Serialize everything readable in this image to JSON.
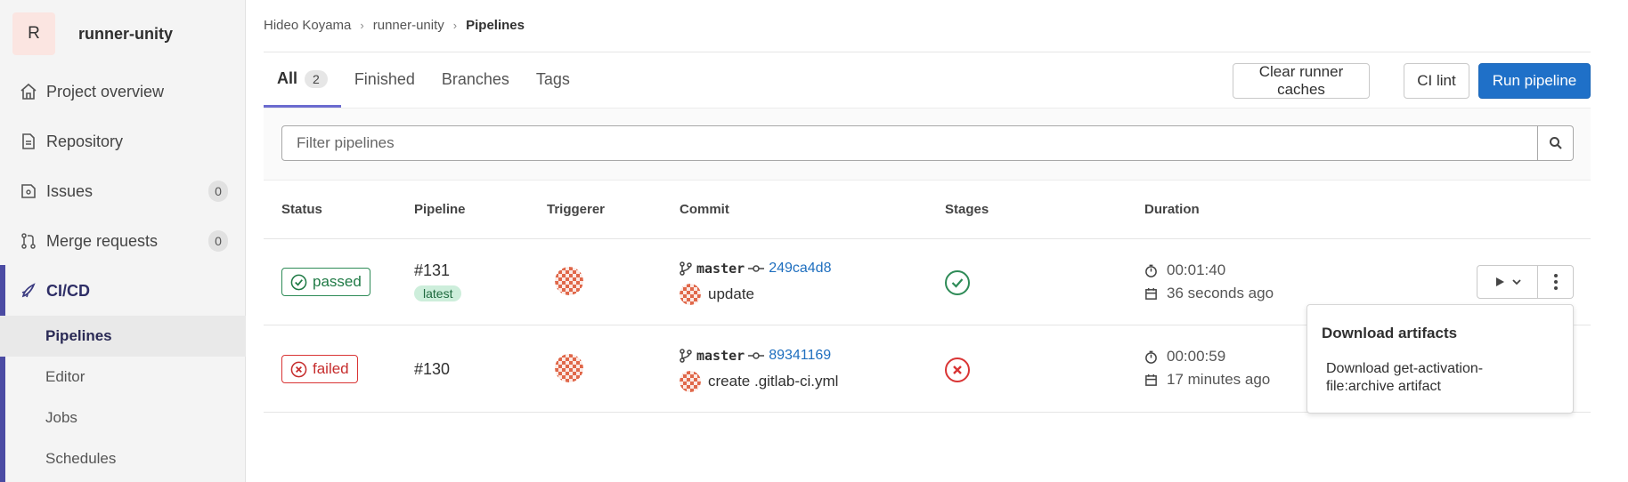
{
  "sidebar": {
    "project": {
      "initial": "R",
      "name": "runner-unity"
    },
    "items": [
      {
        "label": "Project overview",
        "icon": "home-icon"
      },
      {
        "label": "Repository",
        "icon": "doc-icon"
      },
      {
        "label": "Issues",
        "icon": "issues-icon",
        "count": "0"
      },
      {
        "label": "Merge requests",
        "icon": "merge-request-icon",
        "count": "0"
      },
      {
        "label": "CI/CD",
        "icon": "rocket-icon"
      }
    ],
    "subitems": [
      {
        "label": "Pipelines",
        "active": true
      },
      {
        "label": "Editor"
      },
      {
        "label": "Jobs"
      },
      {
        "label": "Schedules"
      }
    ]
  },
  "breadcrumb": [
    "Hideo Koyama",
    "runner-unity",
    "Pipelines"
  ],
  "tabs": [
    {
      "label": "All",
      "count": "2",
      "active": true
    },
    {
      "label": "Finished"
    },
    {
      "label": "Branches"
    },
    {
      "label": "Tags"
    }
  ],
  "actions": {
    "clear_caches": "Clear runner caches",
    "ci_lint": "CI lint",
    "run_pipeline": "Run pipeline"
  },
  "filter": {
    "placeholder": "Filter pipelines"
  },
  "table": {
    "headers": [
      "Status",
      "Pipeline",
      "Triggerer",
      "Commit",
      "Stages",
      "Duration"
    ],
    "rows": [
      {
        "status": "passed",
        "pipeline_id": "#131",
        "tag": "latest",
        "branch": "master",
        "sha": "249ca4d8",
        "message": "update",
        "stage_status": "success",
        "duration": "00:01:40",
        "finished": "36 seconds ago"
      },
      {
        "status": "failed",
        "pipeline_id": "#130",
        "branch": "master",
        "sha": "89341169",
        "message": "create .gitlab-ci.yml",
        "stage_status": "failed",
        "duration": "00:00:59",
        "finished": "17 minutes ago"
      }
    ]
  },
  "dropdown": {
    "title": "Download artifacts",
    "item": "Download get-activation-file:archive artifact"
  },
  "colors": {
    "primary": "#1f70c8",
    "success": "#2e8b57",
    "danger": "#d93434",
    "accent": "#4b4ba3"
  }
}
